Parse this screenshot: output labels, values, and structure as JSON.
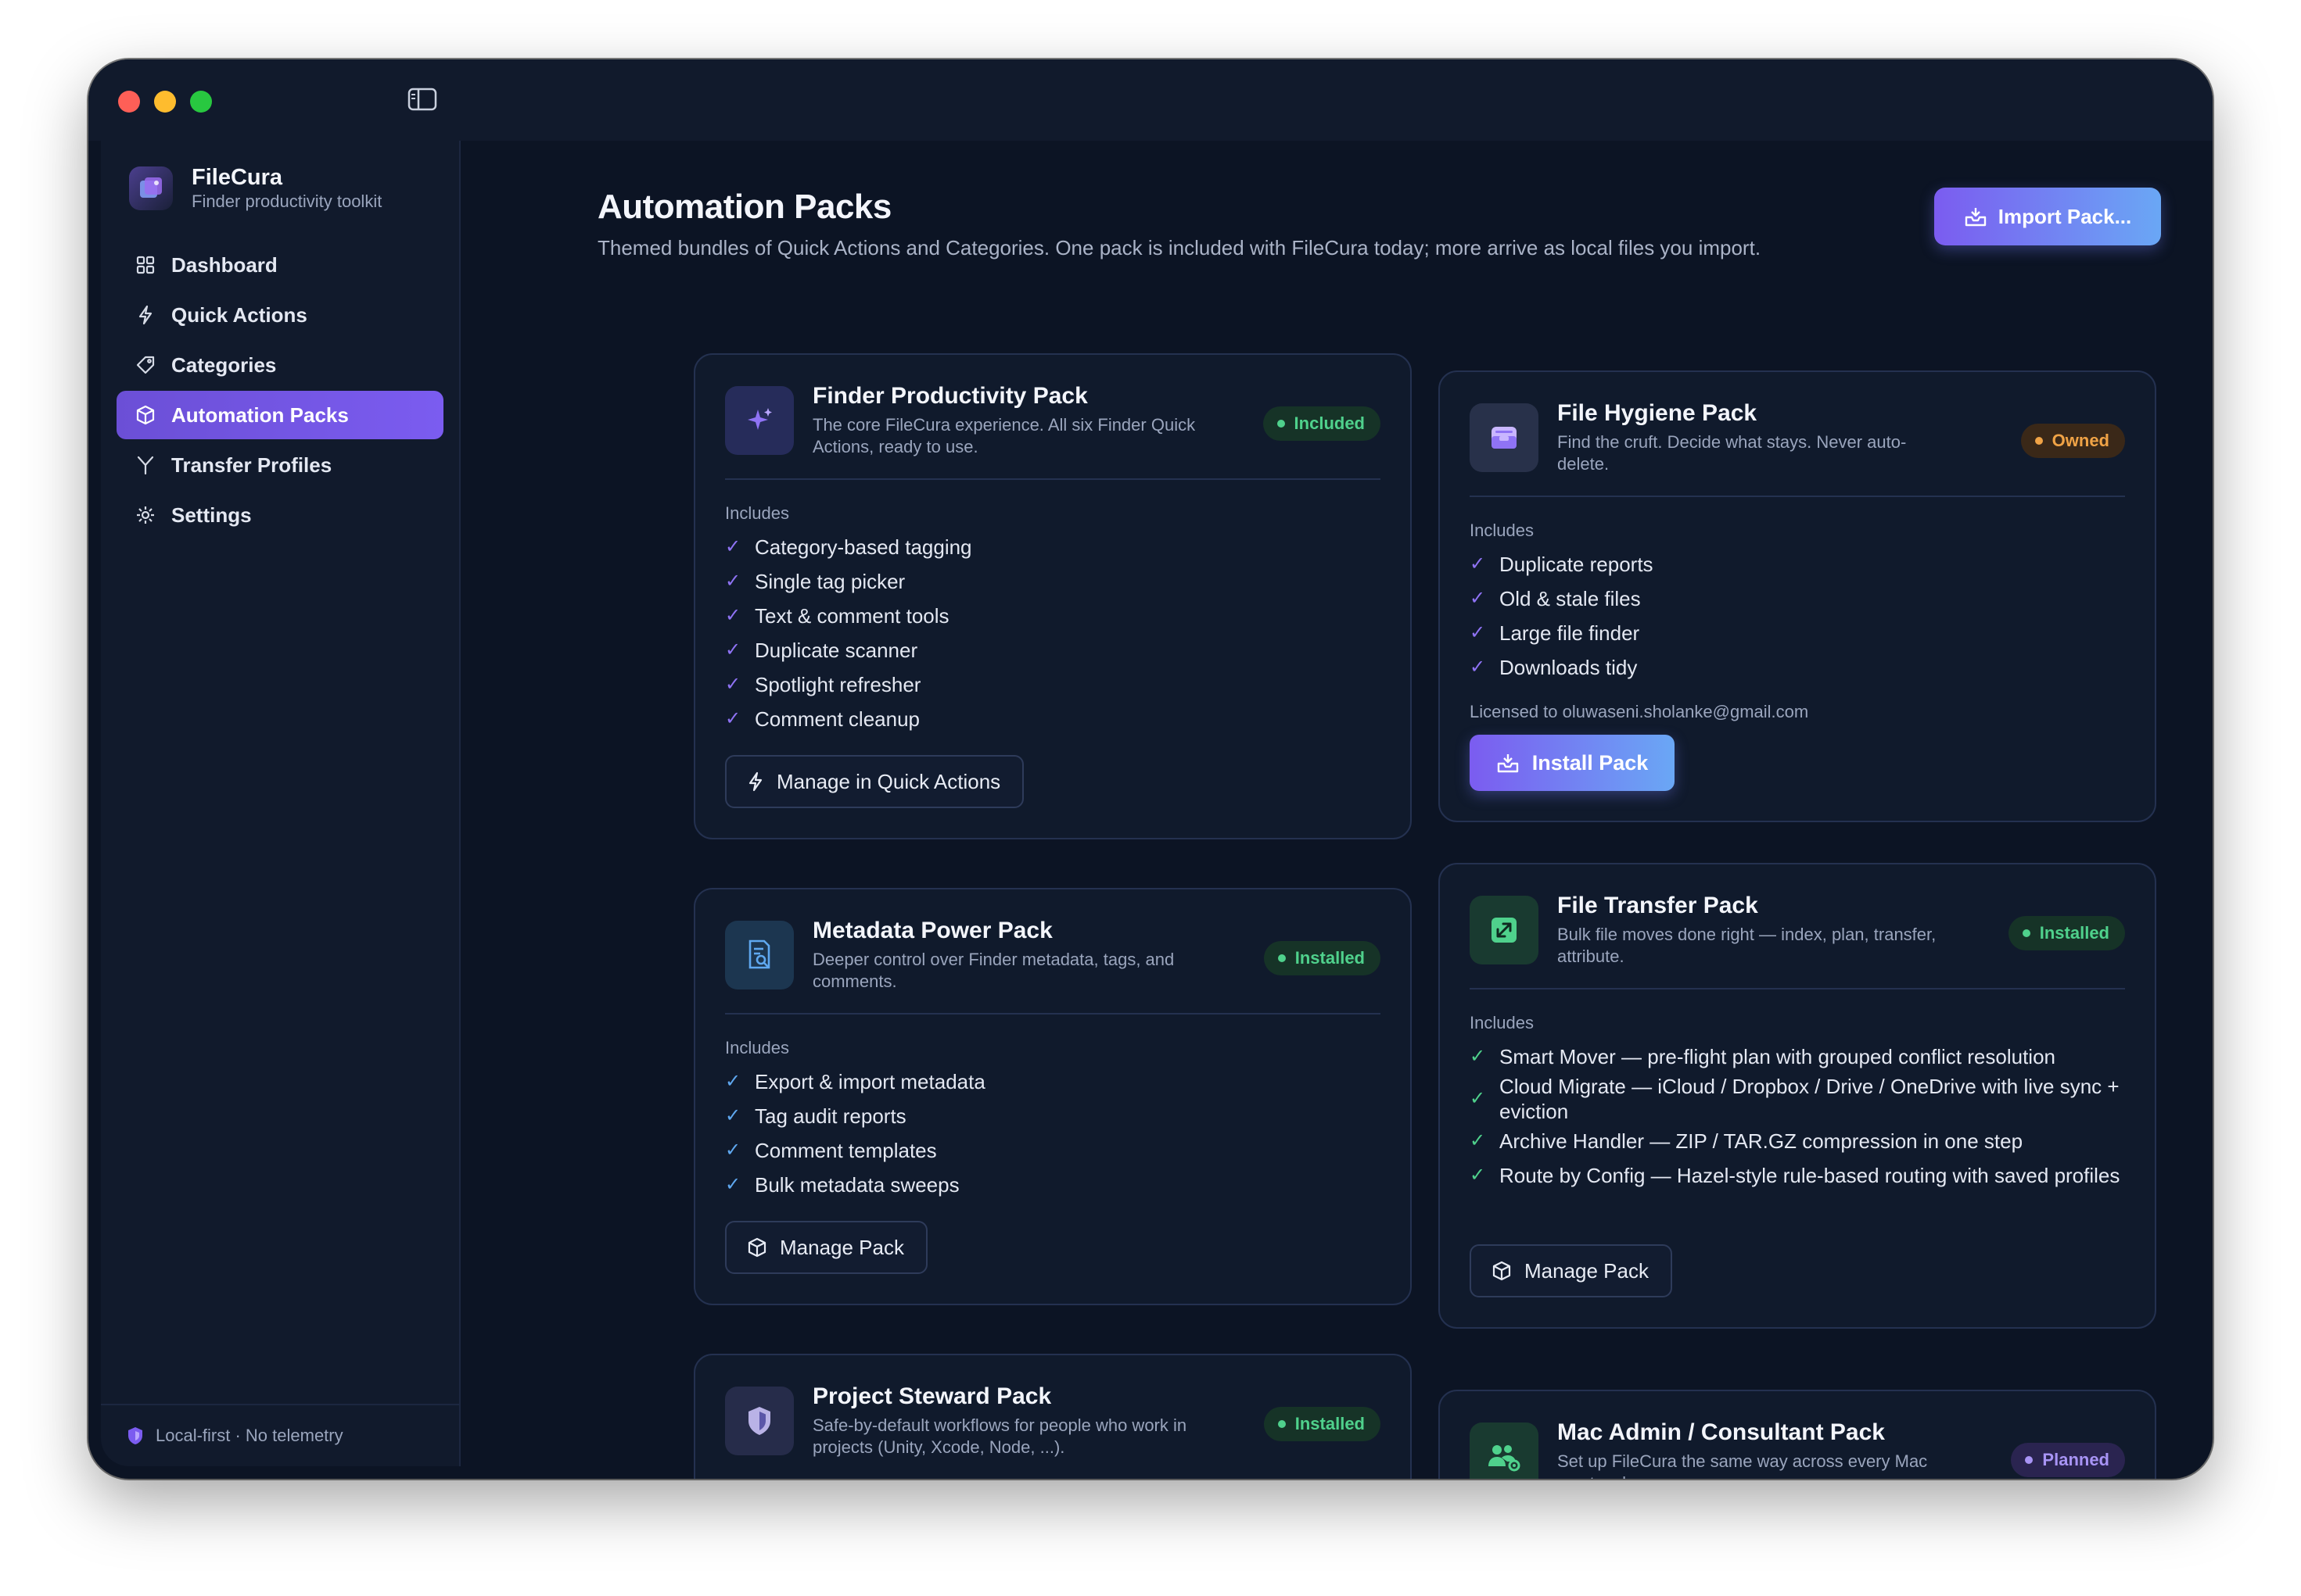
{
  "app": {
    "name": "FileCura",
    "tagline": "Finder productivity toolkit"
  },
  "sidebar": {
    "items": [
      {
        "label": "Dashboard",
        "icon": "grid-icon",
        "active": false
      },
      {
        "label": "Quick Actions",
        "icon": "bolt-icon",
        "active": false
      },
      {
        "label": "Categories",
        "icon": "tag-icon",
        "active": false
      },
      {
        "label": "Automation Packs",
        "icon": "cube-icon",
        "active": true
      },
      {
        "label": "Transfer Profiles",
        "icon": "fork-icon",
        "active": false
      },
      {
        "label": "Settings",
        "icon": "gear-icon",
        "active": false
      }
    ],
    "footer": "Local-first · No telemetry"
  },
  "header": {
    "title": "Automation Packs",
    "subtitle": "Themed bundles of Quick Actions and Categories. One pack is included with FileCura today; more arrive as local files you import.",
    "import_label": "Import Pack..."
  },
  "colors": {
    "accent": "#7b5cf0",
    "accent_end": "#6aa7f5",
    "included": "#4fd18c",
    "owned": "#f0a346",
    "planned": "#a894f5",
    "background": "#0c1424"
  },
  "includes_label": "Includes",
  "packs": [
    {
      "name": "Finder Productivity Pack",
      "description": "The core FileCura experience. All six Finder Quick Actions, ready to use.",
      "status": "Included",
      "icon": "sparkles-icon",
      "features": [
        "Category-based tagging",
        "Single tag picker",
        "Text & comment tools",
        "Duplicate scanner",
        "Spotlight refresher",
        "Comment cleanup"
      ],
      "action": "Manage in Quick Actions"
    },
    {
      "name": "File Hygiene Pack",
      "description": "Find the cruft. Decide what stays. Never auto-delete.",
      "status": "Owned",
      "icon": "tray-icon",
      "features": [
        "Duplicate reports",
        "Old & stale files",
        "Large file finder",
        "Downloads tidy"
      ],
      "licensed": "Licensed to oluwaseni.sholanke@gmail.com",
      "action": "Install Pack"
    },
    {
      "name": "Metadata Power Pack",
      "description": "Deeper control over Finder metadata, tags, and comments.",
      "status": "Installed",
      "icon": "document-search-icon",
      "features": [
        "Export & import metadata",
        "Tag audit reports",
        "Comment templates",
        "Bulk metadata sweeps"
      ],
      "action": "Manage Pack"
    },
    {
      "name": "File Transfer Pack",
      "description": "Bulk file moves done right — index, plan, transfer, attribute.",
      "status": "Installed",
      "icon": "arrows-in-icon",
      "features": [
        "Smart Mover — pre-flight plan with grouped conflict resolution",
        "Cloud Migrate — iCloud / Dropbox / Drive / OneDrive with live sync + eviction",
        "Archive Handler — ZIP / TAR.GZ compression in one step",
        "Route by Config — Hazel-style rule-based routing with saved profiles"
      ],
      "action": "Manage Pack"
    },
    {
      "name": "Project Steward Pack",
      "description": "Safe-by-default workflows for people who work in projects (Unity, Xcode, Node, ...).",
      "status": "Installed",
      "icon": "shield-icon"
    },
    {
      "name": "Mac Admin / Consultant Pack",
      "description": "Set up FileCura the same way across every Mac you touch.",
      "status": "Planned",
      "icon": "users-gear-icon"
    }
  ]
}
